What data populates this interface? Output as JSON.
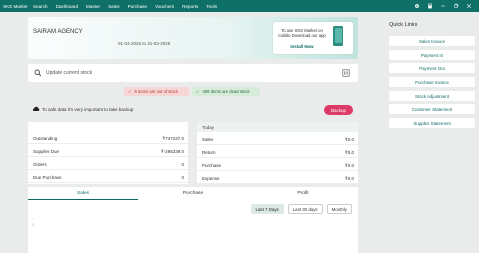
{
  "app": {
    "title": "SKS Market"
  },
  "menu": [
    "Search",
    "Dashboard",
    "Master",
    "Sales",
    "Purchase",
    "Vouchers",
    "Reports",
    "Tools"
  ],
  "banner": {
    "agency": "SAIRAM AGENCY",
    "date_range": "01-04-2025 to 31-03-2026",
    "promo_text": "To use SKS Market on mobile Download our app",
    "install_label": "Install Now"
  },
  "search": {
    "placeholder": "Update current stock"
  },
  "badges": {
    "out_of_stock": "6 Items are out of stock",
    "dead_stock": "496 Items are dead stock"
  },
  "backup": {
    "text": "To safe data it's very important to take backup",
    "button": "Backup"
  },
  "summary_left": [
    {
      "label": "Outstanding",
      "value": "₹747237.0"
    },
    {
      "label": "Supplier Due",
      "value": "₹-295339.0"
    },
    {
      "label": "Orders",
      "value": "0"
    },
    {
      "label": "Due Purchase",
      "value": "0"
    }
  ],
  "summary_right": {
    "heading": "Today",
    "rows": [
      {
        "label": "Sales",
        "value": "₹0.0"
      },
      {
        "label": "Return",
        "value": "₹0.0"
      },
      {
        "label": "Purchase",
        "value": "₹0.0"
      },
      {
        "label": "Expense",
        "value": "₹0.0"
      }
    ]
  },
  "tabs": [
    "Sales",
    "Purchase",
    "Profit"
  ],
  "period_buttons": [
    "Last 7 Days",
    "Last 30 days",
    "Monthly"
  ],
  "chart_axis_label": "1",
  "quick_links": {
    "title": "Quick Links",
    "items": [
      "Sales Invoice",
      "Payment In",
      "Payment Out",
      "Purchase Invoice",
      "Stock Adjustment",
      "Customer Statement",
      "Supplier Statement"
    ]
  },
  "colors": {
    "brand": "#0f7068",
    "danger": "#dc3b65"
  }
}
